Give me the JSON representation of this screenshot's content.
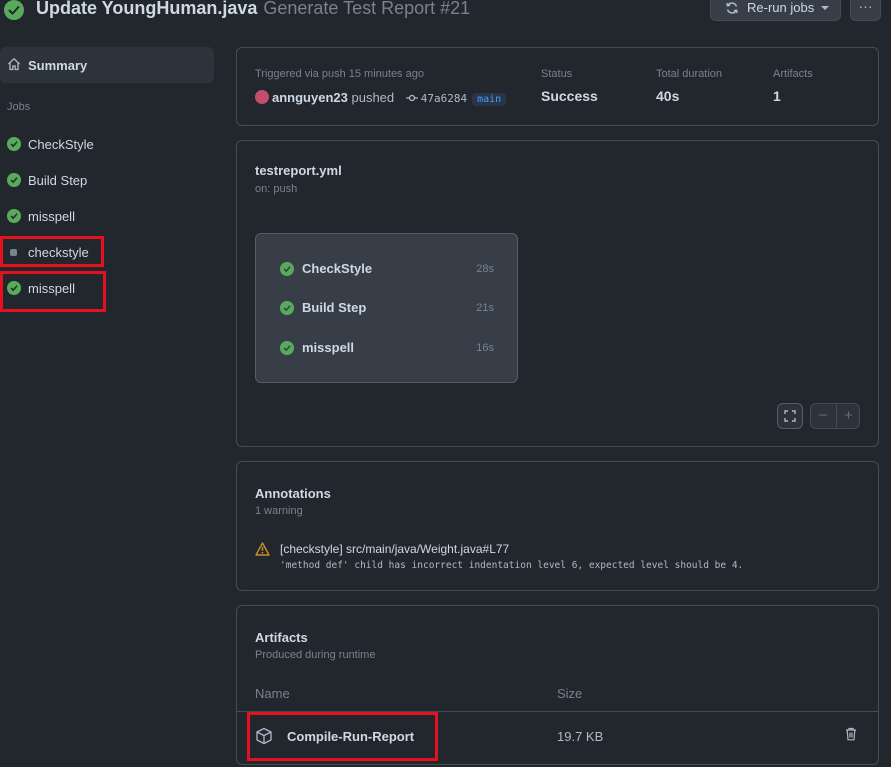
{
  "header": {
    "commit_title": "Update YoungHuman.java",
    "workflow_run": "Generate Test Report #21",
    "rerun_label": "Re-run jobs",
    "more_label": "···"
  },
  "sidebar": {
    "summary_label": "Summary",
    "jobs_heading": "Jobs",
    "jobs": [
      {
        "label": "CheckStyle",
        "status": "success"
      },
      {
        "label": "Build Step",
        "status": "success"
      },
      {
        "label": "misspell",
        "status": "success"
      },
      {
        "label": "checkstyle",
        "status": "queued"
      },
      {
        "label": "misspell",
        "status": "success"
      }
    ]
  },
  "run": {
    "trigger_label": "Triggered via push 15 minutes ago",
    "actor": "annguyen23",
    "action": "pushed",
    "sha": "47a6284",
    "branch": "main",
    "status_label": "Status",
    "status_value": "Success",
    "duration_label": "Total duration",
    "duration_value": "40s",
    "artifacts_label": "Artifacts",
    "artifacts_value": "1"
  },
  "graph": {
    "file": "testreport.yml",
    "event": "on: push",
    "jobs": [
      {
        "label": "CheckStyle",
        "duration": "28s"
      },
      {
        "label": "Build Step",
        "duration": "21s"
      },
      {
        "label": "misspell",
        "duration": "16s"
      }
    ]
  },
  "annotations": {
    "title": "Annotations",
    "count": "1 warning",
    "items": [
      {
        "title": "[checkstyle] src/main/java/Weight.java#L77",
        "message": "'method def' child has incorrect indentation level 6, expected level should be 4."
      }
    ]
  },
  "artifacts": {
    "title": "Artifacts",
    "subtitle": "Produced during runtime",
    "col_name": "Name",
    "col_size": "Size",
    "items": [
      {
        "name": "Compile-Run-Report",
        "size": "19.7 KB"
      }
    ]
  },
  "colors": {
    "success": "#57ab5a",
    "warning": "#c69026",
    "highlight": "#e5121e",
    "link": "#539bf5"
  },
  "icons": [
    "check-circle-icon",
    "home-icon",
    "sync-icon",
    "kebab-icon",
    "commit-icon",
    "screen-full-icon",
    "alert-icon",
    "package-icon",
    "trash-icon"
  ]
}
